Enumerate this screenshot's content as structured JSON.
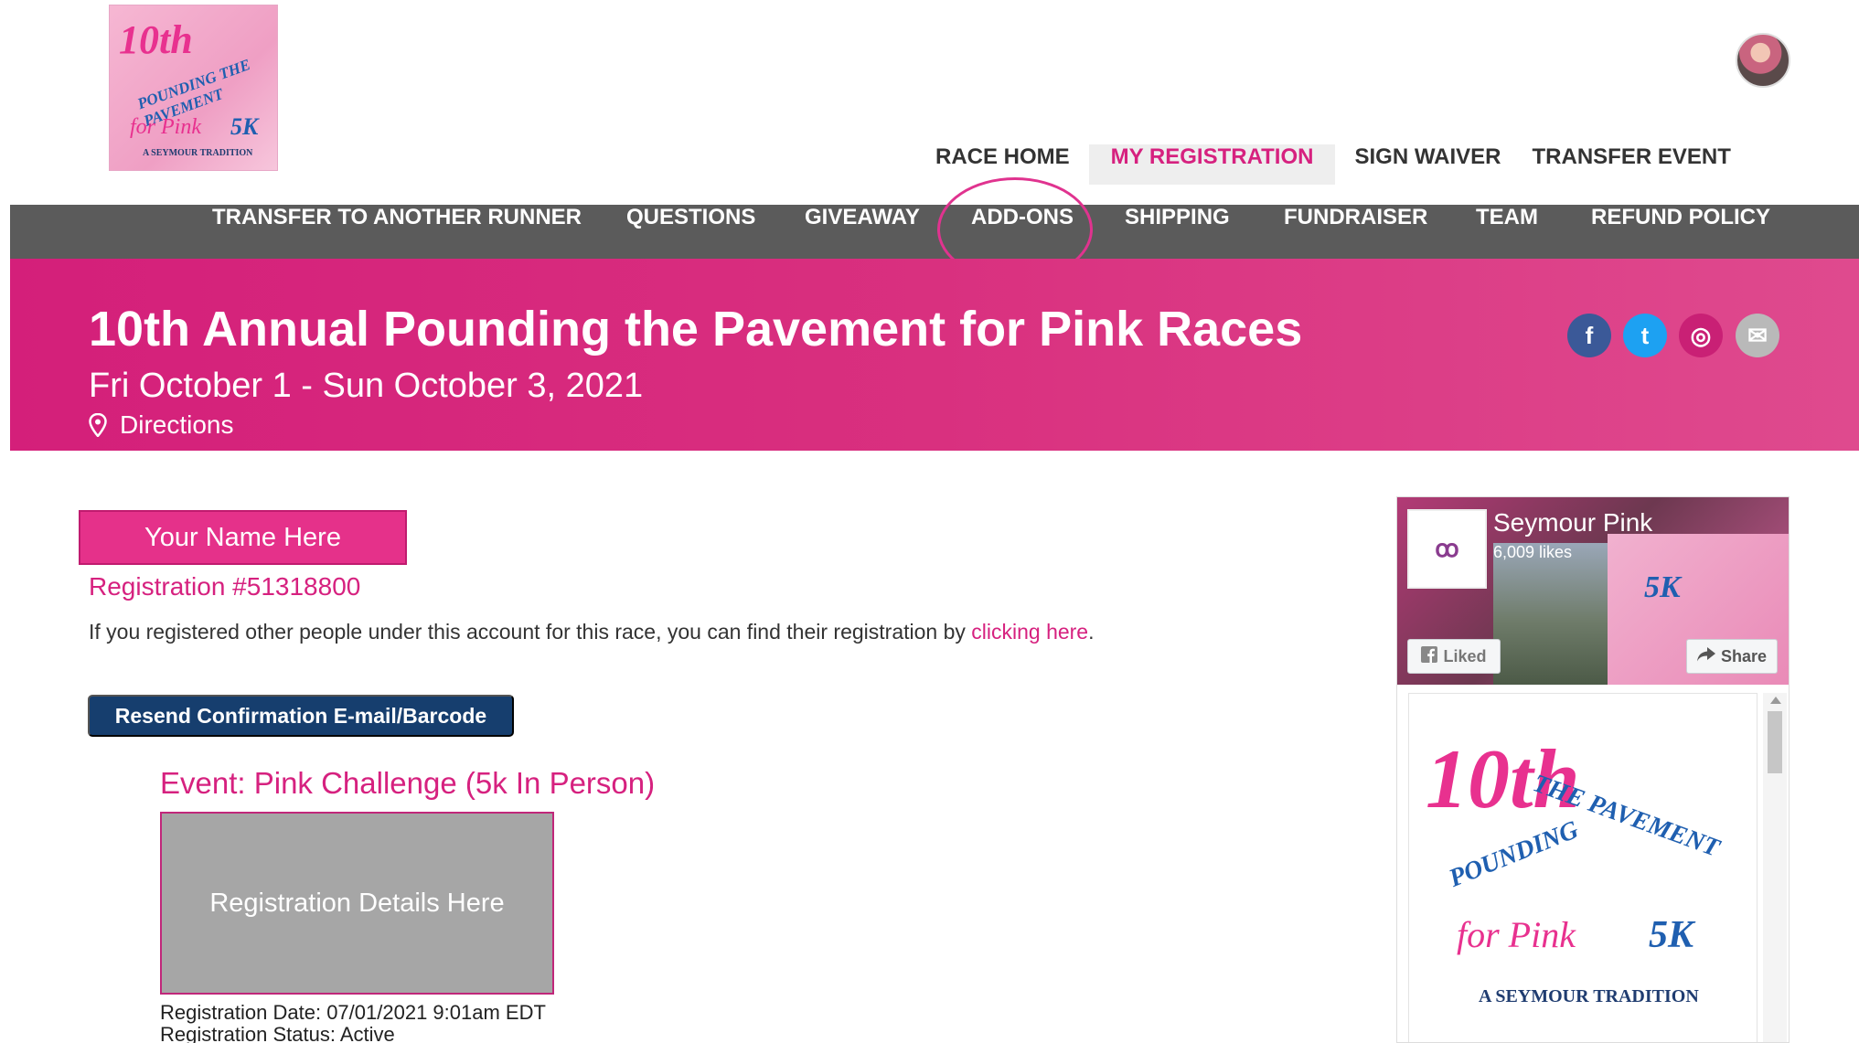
{
  "logo": {
    "line1": "10th",
    "line2": "POUNDING THE PAVEMENT",
    "line3": "for Pink",
    "line4": "5K",
    "line5": "A SEYMOUR TRADITION"
  },
  "top_nav": [
    {
      "label": "RACE HOME",
      "active": false
    },
    {
      "label": "MY REGISTRATION",
      "active": true
    },
    {
      "label": "SIGN WAIVER",
      "active": false
    },
    {
      "label": "TRANSFER EVENT",
      "active": false
    }
  ],
  "sub_nav": [
    {
      "label": "TRANSFER TO ANOTHER RUNNER"
    },
    {
      "label": "QUESTIONS"
    },
    {
      "label": "GIVEAWAY"
    },
    {
      "label": "ADD-ONS"
    },
    {
      "label": "SHIPPING"
    },
    {
      "label": "FUNDRAISER"
    },
    {
      "label": "TEAM"
    },
    {
      "label": "REFUND POLICY"
    }
  ],
  "banner": {
    "title": "10th Annual Pounding the Pavement for Pink Races",
    "dates": "Fri October 1 - Sun October 3, 2021",
    "directions": "Directions",
    "social": [
      {
        "name": "facebook-icon",
        "glyph": "f",
        "color": "#3b5998"
      },
      {
        "name": "twitter-icon",
        "glyph": "t",
        "color": "#1da1f2"
      },
      {
        "name": "instagram-icon",
        "glyph": "◎",
        "color": "#c92075"
      },
      {
        "name": "email-icon",
        "glyph": "✉",
        "color": "#b9b9b9"
      }
    ]
  },
  "main": {
    "name_placeholder": "Your Name Here",
    "registration_number": "Registration #51318800",
    "info_text": "If you registered other people under this account for this race, you can find their registration by ",
    "info_link": "clicking here",
    "info_end": ".",
    "resend_label": "Resend Confirmation E-mail/Barcode",
    "event_label": "Event: Pink Challenge (5k In Person)",
    "details_placeholder": "Registration Details Here",
    "registration_date": "Registration Date: 07/01/2021 9:01am EDT",
    "registration_status": "Registration Status: Active"
  },
  "facebook": {
    "page_name": "Seymour Pink",
    "likes": "6,009 likes",
    "liked_label": "Liked",
    "share_label": "Share"
  },
  "colors": {
    "brand_pink": "#d6217f",
    "nav_gray": "#5b5b5b",
    "button_navy": "#163e6e"
  }
}
